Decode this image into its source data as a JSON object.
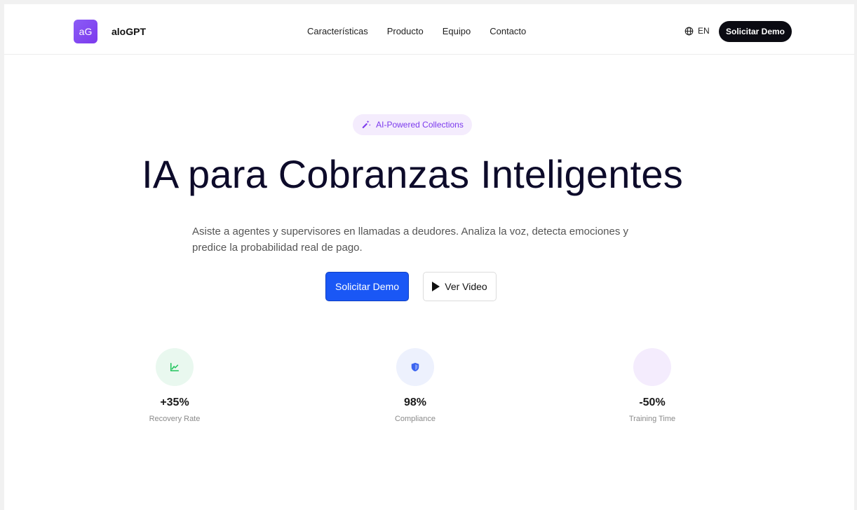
{
  "nav": {
    "logo_text": "aG",
    "brand": "aloGPT",
    "menu": [
      "Características",
      "Producto",
      "Equipo",
      "Contacto"
    ],
    "lang_label": "EN",
    "cta_label": "Solicitar Demo"
  },
  "hero": {
    "badge_label": "AI-Powered Collections",
    "title": "IA para Cobranzas Inteligentes",
    "subtitle": "Asiste a agentes y supervisores en llamadas a deudores. Analiza la voz, detecta emociones y predice la probabilidad real de pago.",
    "primary_button": "Solicitar Demo",
    "secondary_button": "Ver Video"
  },
  "stats": [
    {
      "value": "+35%",
      "label": "Recovery Rate",
      "icon": "trending-up-icon",
      "bg": "#e9f8ef",
      "fg": "#22c55e"
    },
    {
      "value": "98%",
      "label": "Compliance",
      "icon": "shield-icon",
      "bg": "#edf1fd",
      "fg": "#3b64f0"
    },
    {
      "value": "-50%",
      "label": "Training Time",
      "icon": "clock-icon",
      "bg": "#f4ecfd",
      "fg": "#a855f7"
    }
  ],
  "colors": {
    "accent": "#1a57f5",
    "dark": "#0b0b12",
    "brand_purple": "#7c3aed"
  }
}
